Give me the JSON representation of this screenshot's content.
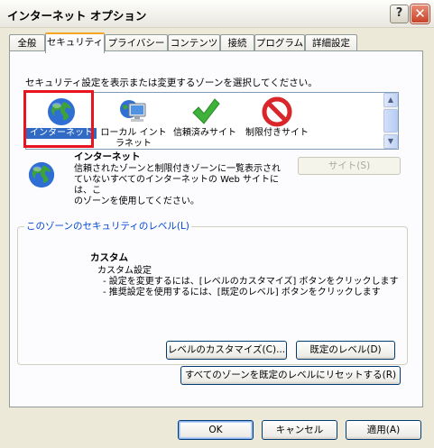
{
  "window": {
    "title": "インターネット オプション",
    "help_label": "?",
    "close_label": "✕"
  },
  "tabs": [
    {
      "label": "全般"
    },
    {
      "label": "セキュリティ"
    },
    {
      "label": "プライバシー"
    },
    {
      "label": "コンテンツ"
    },
    {
      "label": "接続"
    },
    {
      "label": "プログラム"
    },
    {
      "label": "詳細設定"
    }
  ],
  "security": {
    "instruction": "セキュリティ設定を表示または変更するゾーンを選択してください。",
    "zones": [
      {
        "label": "インターネット",
        "icon": "globe-icon"
      },
      {
        "label": "ローカル イントラネット",
        "icon": "local-intranet-icon"
      },
      {
        "label": "信頼済みサイト",
        "icon": "checkmark-icon"
      },
      {
        "label": "制限付きサイト",
        "icon": "prohibited-icon"
      }
    ],
    "selected_zone": {
      "name": "インターネット",
      "desc1": "信頼されたゾーンと制限付きゾーンに一覧表示され",
      "desc2": "ていないすべてのインターネットの Web サイトには、こ",
      "desc3": "のゾーンを使用してください。"
    },
    "sites_button": "サイト(S)",
    "level_group": "このゾーンのセキュリティのレベル(L)",
    "level": {
      "name": "カスタム",
      "line1": "カスタム設定",
      "line2": "- 設定を変更するには、[レベルのカスタマイズ] ボタンをクリックします",
      "line3": "- 推奨設定を使用するには、[既定のレベル] ボタンをクリックします"
    },
    "customize_button": "レベルのカスタマイズ(C)...",
    "default_level_button": "既定のレベル(D)",
    "reset_all_button": "すべてのゾーンを既定のレベルにリセットする(R)"
  },
  "footer": {
    "ok": "OK",
    "cancel": "キャンセル",
    "apply": "適用(A)"
  },
  "colors": {
    "selection": "#316ac5",
    "highlight_box": "#e8141e",
    "group_label": "#0046d5"
  }
}
